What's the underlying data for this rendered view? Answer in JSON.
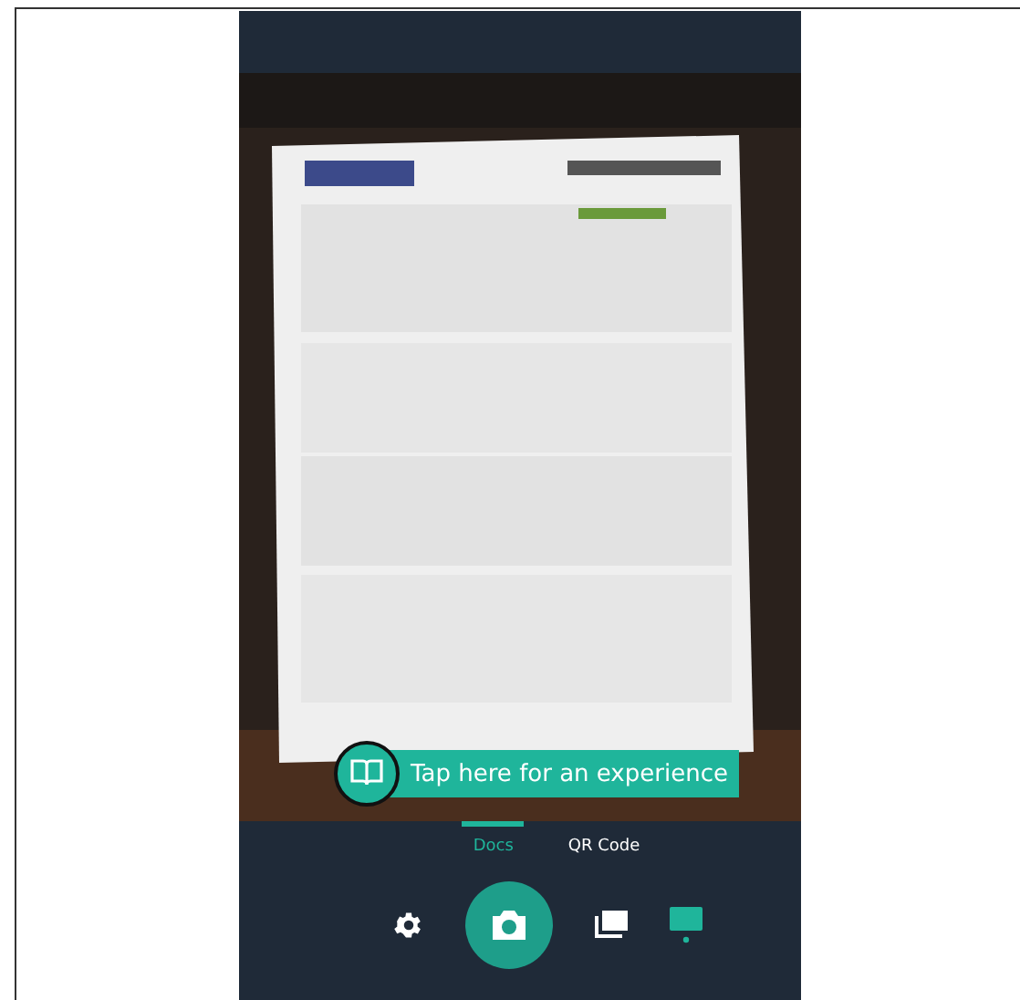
{
  "tip": {
    "text": "Tap here for an experience"
  },
  "tabs": [
    {
      "label": "Docs",
      "selected": true
    },
    {
      "label": "QR Code",
      "selected": false
    }
  ],
  "mode_indicator": {
    "selected": true
  }
}
